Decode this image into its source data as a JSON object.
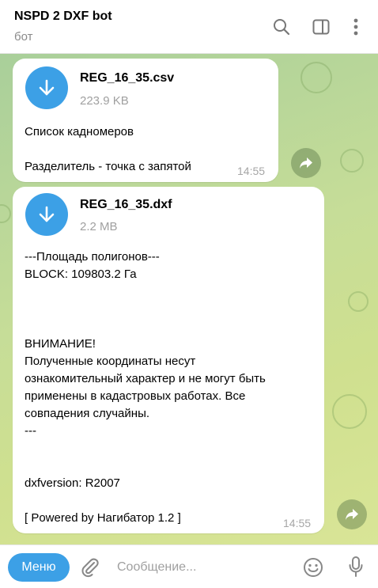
{
  "header": {
    "title": "NSPD 2 DXF bot",
    "subtitle": "бот"
  },
  "messages": [
    {
      "file_name": "REG_16_35.csv",
      "file_size": "223.9 KB",
      "text": "Список кадномеров\n\nРазделитель - точка с запятой",
      "time": "14:55"
    },
    {
      "file_name": "REG_16_35.dxf",
      "file_size": "2.2 MB",
      "text": "---Площадь полигонов---\nBLOCK: 109803.2 Га\n\n\n\nВНИМАНИЕ!\nПолученные координаты несут\nознакомительный характер и не могут быть\nприменены в кадастровых работах. Все\nсовпадения случайны.\n---\n\n\ndxfversion: R2007\n\n[ Powered by Нагибатор 1.2 ]",
      "time": "14:55"
    }
  ],
  "composer": {
    "menu_label": "Меню",
    "placeholder": "Сообщение..."
  },
  "colors": {
    "accent": "#3ca0e6",
    "header_bg": "#ffffff",
    "chat_bg": "#c6dd98"
  },
  "icons": [
    "search-icon",
    "sidebar-icon",
    "more-icon",
    "download-icon",
    "forward-icon",
    "attach-icon",
    "emoji-icon",
    "mic-icon"
  ]
}
